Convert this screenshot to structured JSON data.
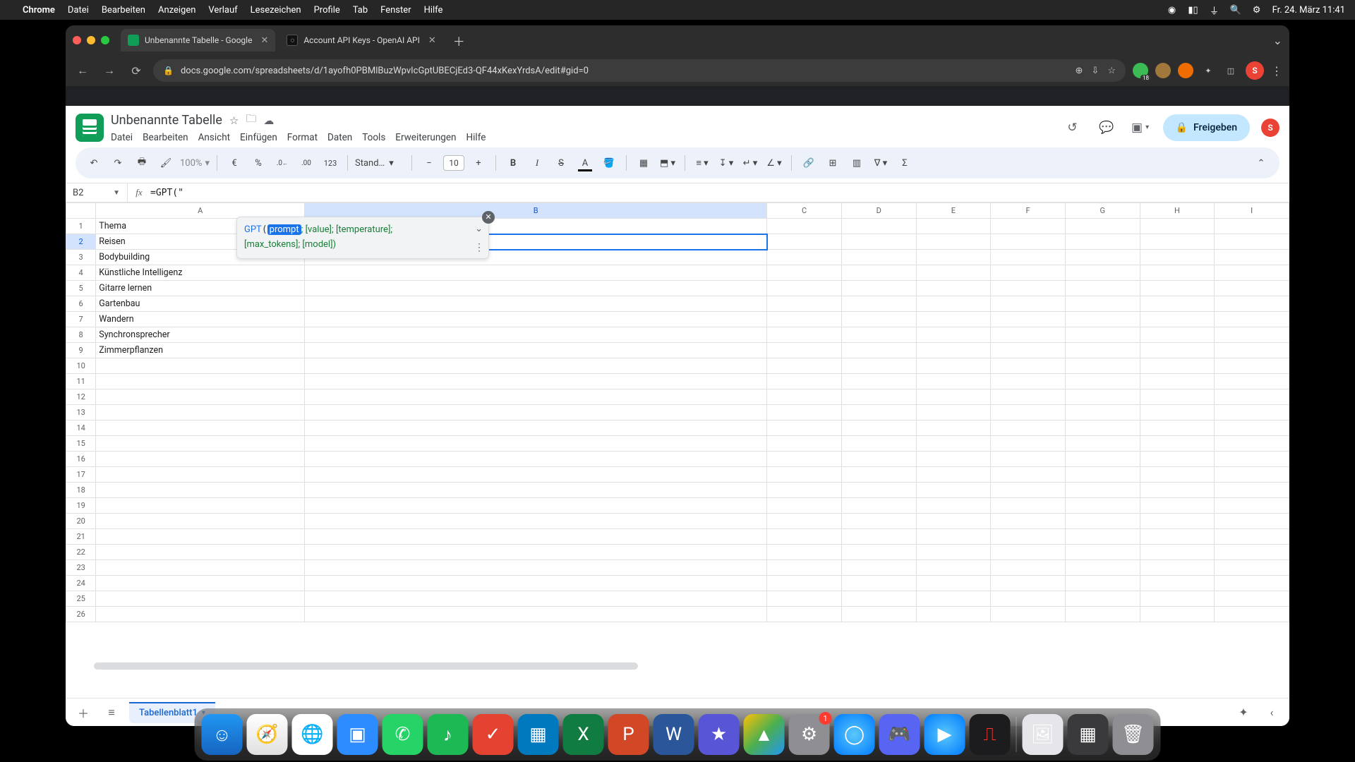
{
  "mac_menu": {
    "app": "Chrome",
    "items": [
      "Datei",
      "Bearbeiten",
      "Anzeigen",
      "Verlauf",
      "Lesezeichen",
      "Profile",
      "Tab",
      "Fenster",
      "Hilfe"
    ],
    "clock": "Fr. 24. März  11:41"
  },
  "browser": {
    "tabs": [
      {
        "title": "Unbenannte Tabelle - Google",
        "active": true,
        "favicon": "sheets"
      },
      {
        "title": "Account API Keys - OpenAI API",
        "active": false,
        "favicon": "openai"
      }
    ],
    "url": "docs.google.com/spreadsheets/d/1ayofh0PBMlBuzWpvIcGptUBECjEd3-QF44xKexYrdsA/edit#gid=0",
    "ext_badge": "18",
    "avatar_letter": "S"
  },
  "sheets": {
    "doc_title": "Unbenannte Tabelle",
    "menus": [
      "Datei",
      "Bearbeiten",
      "Ansicht",
      "Einfügen",
      "Format",
      "Daten",
      "Tools",
      "Erweiterungen",
      "Hilfe"
    ],
    "share_label": "Freigeben",
    "toolbar": {
      "zoom": "100%",
      "currency": "€",
      "percent": "%",
      "dec_dec": ".0←",
      "dec_inc": ".00",
      "num_fmt": "123",
      "font": "Stand…",
      "font_size": "10"
    },
    "name_box": "B2",
    "formula": "=GPT(\"",
    "tooltip": {
      "fn": "GPT",
      "current_param": "prompt",
      "rest_line1": "; [value]; [temperature];",
      "line2": "[max_tokens]; [model])"
    },
    "columns": [
      "A",
      "B",
      "C",
      "D",
      "E",
      "F",
      "G",
      "H",
      "I"
    ],
    "rows_a": [
      "Thema",
      "Reisen",
      "Bodybuilding",
      "Künstliche Intelligenz",
      "Gitarre lernen",
      "Gartenbau",
      "Wandern",
      "Synchronsprecher",
      "Zimmerpflanzen"
    ],
    "sheet_tab": "Tabellenblatt1"
  },
  "dock": {
    "settings_badge": "1"
  }
}
